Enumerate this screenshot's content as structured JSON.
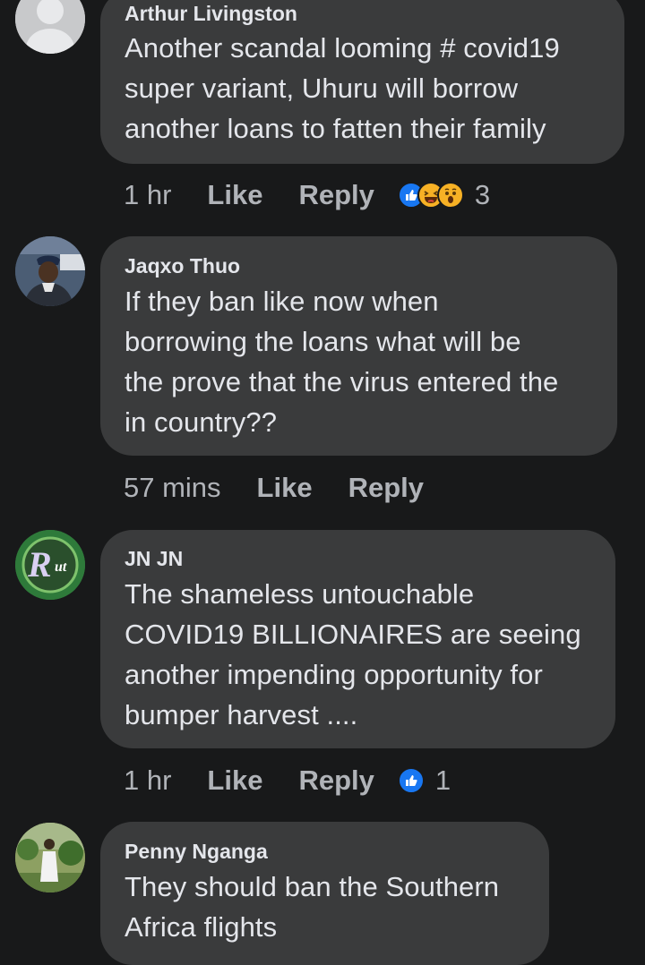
{
  "comments": [
    {
      "author": "Arthur Livingston",
      "lines": [
        "Another scandal looming # covid19",
        "super variant, Uhuru will borrow",
        "another loans to fatten their family"
      ],
      "time": "1 hr",
      "like": "Like",
      "reply": "Reply",
      "reactions": [
        "like-reaction-icon",
        "haha-reaction-icon",
        "wow-reaction-icon"
      ],
      "reaction_count": "3"
    },
    {
      "author": "Jaqxo Thuo",
      "lines": [
        "If they ban like now when",
        "borrowing the loans what will be",
        "the prove that the virus entered the",
        "in country??"
      ],
      "time": "57 mins",
      "like": "Like",
      "reply": "Reply"
    },
    {
      "author": "JN JN",
      "lines": [
        "The shameless untouchable",
        "COVID19 BILLIONAIRES are seeing",
        "another impending opportunity for",
        "bumper harvest ...."
      ],
      "time": "1 hr",
      "like": "Like",
      "reply": "Reply",
      "reactions": [
        "like-reaction-icon"
      ],
      "reaction_count": "1"
    },
    {
      "author": "Penny Nganga",
      "lines": [
        "They should ban the Southern",
        "Africa flights"
      ]
    }
  ],
  "colors": {
    "background": "#18191a",
    "bubble": "#3a3b3c",
    "text": "#e4e6eb",
    "secondary_text": "#b0b3b8",
    "like_blue": "#1877f2",
    "reaction_yellow": "#f7b125"
  }
}
